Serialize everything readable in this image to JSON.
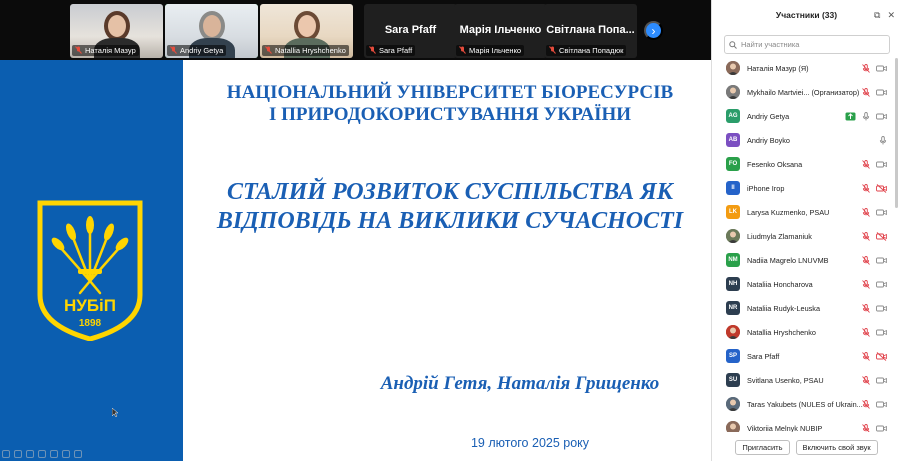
{
  "video_strip": {
    "tiles": [
      {
        "name": "Наталія Мазур",
        "type": "video"
      },
      {
        "name": "Andriy Getya",
        "type": "video"
      },
      {
        "name": "Natallia Hryshchenko",
        "type": "video"
      },
      {
        "name": "Sara Pfaff",
        "big_name": "Sara Pfaff",
        "type": "name"
      },
      {
        "name": "Марія Ільченко",
        "big_name": "Марія Ільченко",
        "type": "name"
      },
      {
        "name": "Світлана Попадюк",
        "big_name": "Світлана Попа...",
        "type": "name"
      }
    ],
    "next_icon": "chevron-right-icon"
  },
  "slide": {
    "university_line1": "НАЦІОНАЛЬНИЙ УНІВЕРСИТЕТ БІОРЕСУРСІВ",
    "university_line2": "І ПРИРОДОКОРИСТУВАННЯ УКРАЇНИ",
    "title_line1": "СТАЛИЙ РОЗВИТОК СУСПІЛЬСТВА ЯК",
    "title_line2": "ВІДПОВІДЬ НА ВИКЛИКИ СУЧАСНОСТІ",
    "authors": "Андрій Гетя, Наталія Грищенко",
    "date": "19 лютого  2025 року",
    "logo_text": "НУБіП",
    "logo_year": "1898",
    "colors": {
      "blue": "#0b5eb0",
      "yellow": "#ffd500",
      "title": "#1a5fb4"
    }
  },
  "panel": {
    "title": "Участники (33)",
    "search_placeholder": "Найти участника",
    "participants": [
      {
        "name": "Наталія Мазур (Я)",
        "initials": "",
        "color": "#8a6a5a",
        "photo": true,
        "status": "mic-off-video-off"
      },
      {
        "name": "Mykhailo Martviei... (Организатор)",
        "initials": "",
        "color": "#7a7a7a",
        "photo": true,
        "status": "mic-off-video-off"
      },
      {
        "name": "Andriy Getya",
        "initials": "AG",
        "color": "#2a9d6a",
        "photo": false,
        "status": "sharing-mic-video"
      },
      {
        "name": "Andriy Boyko",
        "initials": "AB",
        "color": "#7b4fc1",
        "photo": false,
        "status": "mic"
      },
      {
        "name": "Fesenko Oksana",
        "initials": "FO",
        "color": "#2aa04a",
        "photo": false,
        "status": "mic-off-video-off"
      },
      {
        "name": "iPhone Iгор",
        "initials": "II",
        "color": "#2563c9",
        "photo": false,
        "status": "mic-off-video-off-red"
      },
      {
        "name": "Larysa Kuzmenko, PSAU",
        "initials": "LK",
        "color": "#f39c12",
        "photo": false,
        "status": "mic-off-video-off"
      },
      {
        "name": "Liudmyla Zlamaniuk",
        "initials": "",
        "color": "#6b7a5a",
        "photo": true,
        "status": "mic-off-video-off-red"
      },
      {
        "name": "Nadiia Magrelo LNUVMB",
        "initials": "NM",
        "color": "#2aa04a",
        "photo": false,
        "status": "mic-off-video-off"
      },
      {
        "name": "Nataliia Honcharova",
        "initials": "NH",
        "color": "#2d3e50",
        "photo": false,
        "status": "mic-off-video-off"
      },
      {
        "name": "Nataliia Rudyk-Leuska",
        "initials": "NR",
        "color": "#2d3e50",
        "photo": false,
        "status": "mic-off-video-off"
      },
      {
        "name": "Natallia Hryshchenko",
        "initials": "",
        "color": "#c0392b",
        "photo": true,
        "status": "mic-off-video-off"
      },
      {
        "name": "Sara Pfaff",
        "initials": "SP",
        "color": "#2563c9",
        "photo": false,
        "status": "mic-off-video-off-red"
      },
      {
        "name": "Svitlana Usenko, PSAU",
        "initials": "SU",
        "color": "#2d3e50",
        "photo": false,
        "status": "mic-off-video-off"
      },
      {
        "name": "Taras Yakubets (NULES of Ukrain...",
        "initials": "",
        "color": "#5a6a7a",
        "photo": true,
        "status": "mic-off-video-off"
      },
      {
        "name": "Viktoriia Melnyk NUBIP",
        "initials": "",
        "color": "#8a6a5a",
        "photo": true,
        "status": "mic-off-video-off"
      }
    ],
    "invite_label": "Пригласить",
    "unmute_label": "Включить свой звук"
  }
}
